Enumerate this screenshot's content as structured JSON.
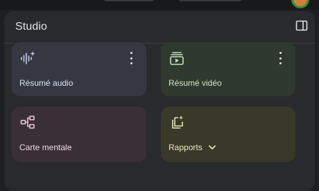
{
  "panel": {
    "title": "Studio",
    "collapse_icon": "panel-toggle-icon"
  },
  "cards": {
    "audio": {
      "label": "Résumé audio",
      "icon": "audio-waveform-icon",
      "color": "#353842"
    },
    "video": {
      "label": "Résumé vidéo",
      "icon": "video-overview-icon",
      "color": "#30392f"
    },
    "mindmap": {
      "label": "Carte mentale",
      "icon": "mind-map-icon",
      "color": "#3b2f36"
    },
    "reports": {
      "label": "Rapports",
      "icon": "reports-icon",
      "color": "#39392a"
    }
  }
}
